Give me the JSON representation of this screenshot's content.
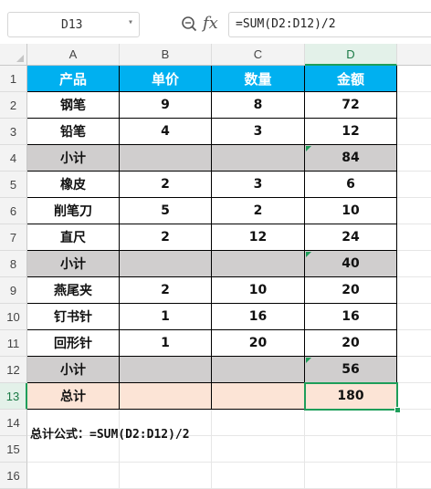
{
  "formula_bar": {
    "name_box": "D13",
    "name_dropdown_icon": "▾",
    "zoom_icon": "magnifier-zoom-icon",
    "fx_label": "fx",
    "formula": "=SUM(D2:D12)/2"
  },
  "columns": [
    "A",
    "B",
    "C",
    "D"
  ],
  "rows": [
    "1",
    "2",
    "3",
    "4",
    "5",
    "6",
    "7",
    "8",
    "9",
    "10",
    "11",
    "12",
    "13",
    "14",
    "15",
    "16"
  ],
  "table": {
    "header": [
      "产品",
      "单价",
      "数量",
      "金额"
    ],
    "body": [
      [
        "钢笔",
        "9",
        "8",
        "72"
      ],
      [
        "铅笔",
        "4",
        "3",
        "12"
      ],
      [
        "小计",
        "",
        "",
        "84"
      ],
      [
        "橡皮",
        "2",
        "3",
        "6"
      ],
      [
        "削笔刀",
        "5",
        "2",
        "10"
      ],
      [
        "直尺",
        "2",
        "12",
        "24"
      ],
      [
        "小计",
        "",
        "",
        "40"
      ],
      [
        "燕尾夹",
        "2",
        "10",
        "20"
      ],
      [
        "钉书针",
        "1",
        "16",
        "16"
      ],
      [
        "回形针",
        "1",
        "20",
        "20"
      ],
      [
        "小计",
        "",
        "",
        "56"
      ],
      [
        "总计",
        "",
        "",
        "180"
      ]
    ]
  },
  "note": "总计公式：=SUM(D2:D12)/2",
  "colors": {
    "header_fill": "#00b0f0",
    "subtotal_fill": "#d0cece",
    "total_fill": "#fce4d6",
    "selection": "#1e9e5a"
  }
}
